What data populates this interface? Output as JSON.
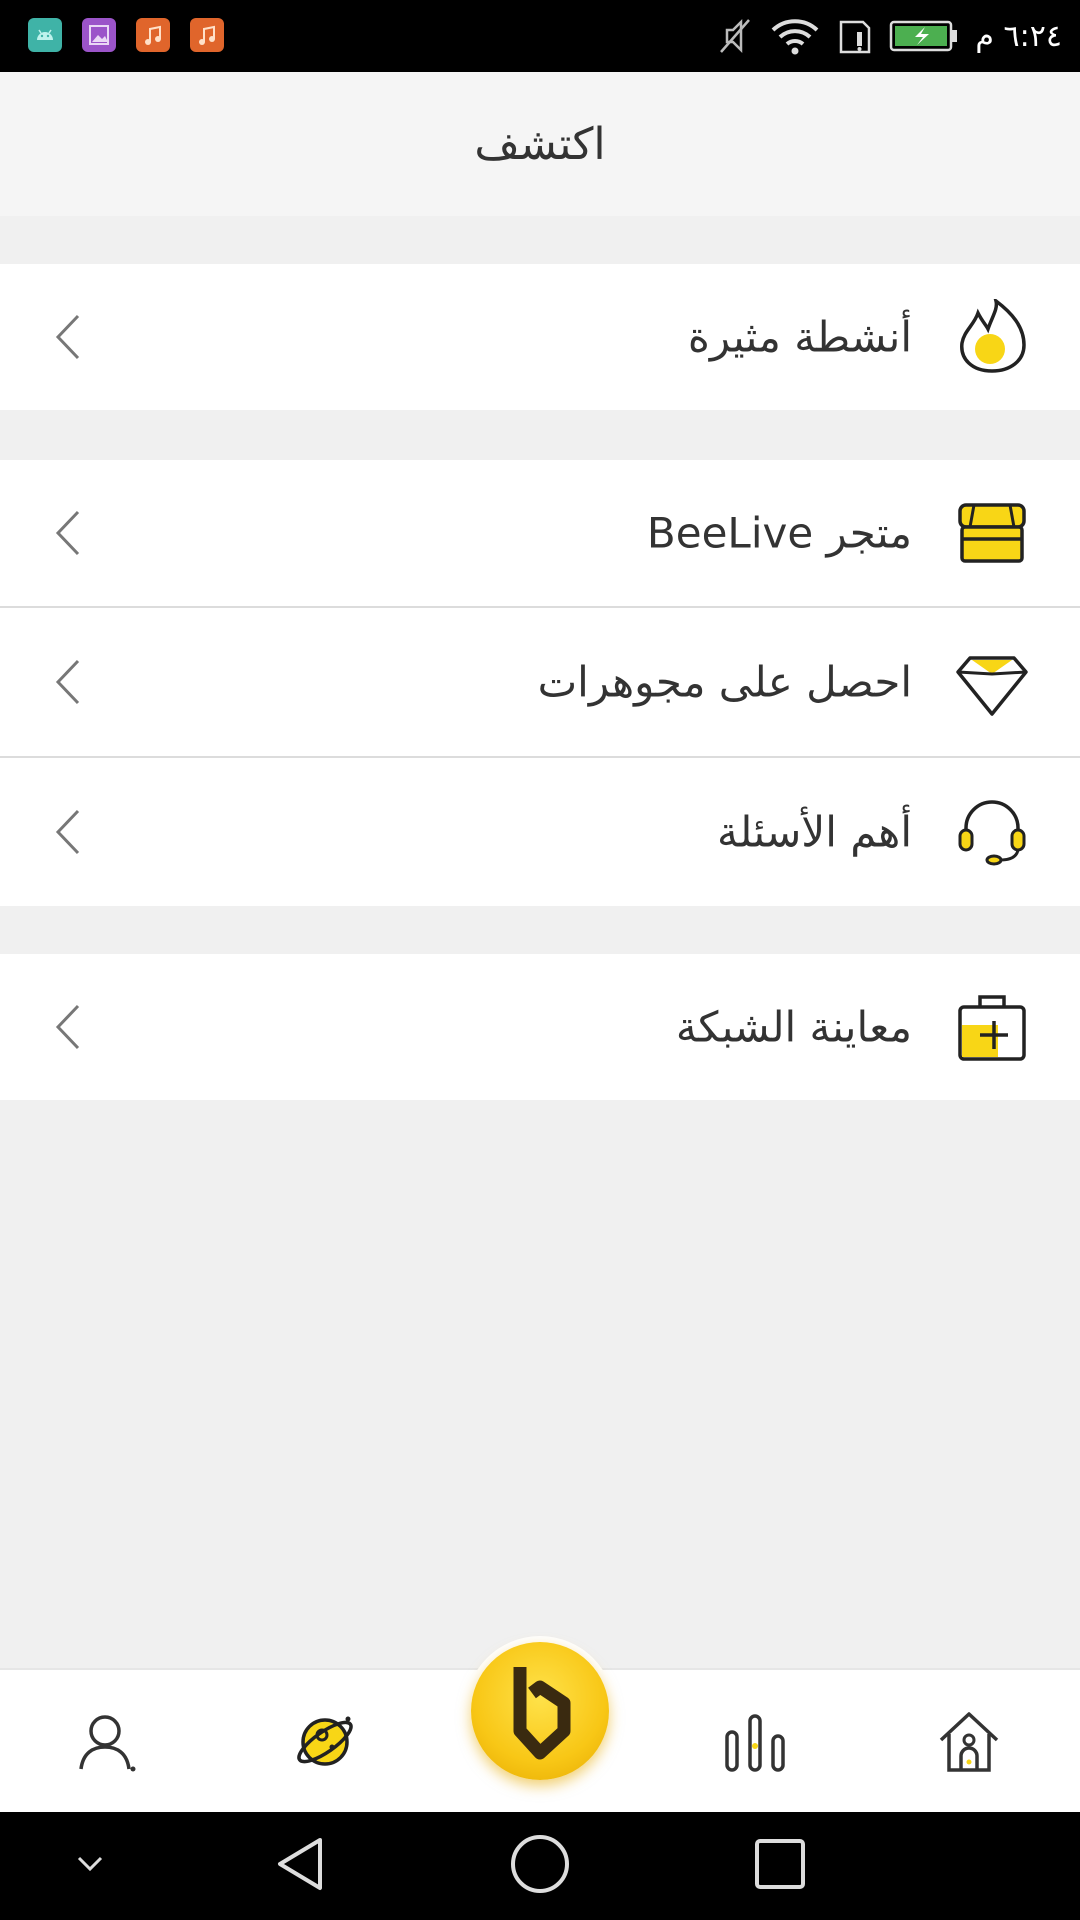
{
  "status_bar": {
    "time": "٦:٢٤ م",
    "notifications": [
      "android-icon",
      "gallery-icon",
      "music-icon",
      "music-icon"
    ]
  },
  "header": {
    "title": "اكتشف"
  },
  "menu": {
    "items": [
      {
        "label": "أنشطة مثيرة",
        "icon": "flame-icon"
      },
      {
        "label": "متجر BeeLive",
        "icon": "store-icon"
      },
      {
        "label": "احصل على مجوهرات",
        "icon": "diamond-icon"
      },
      {
        "label": "أهم الأسئلة",
        "icon": "headset-icon"
      },
      {
        "label": "معاينة الشبكة",
        "icon": "medkit-icon"
      }
    ]
  },
  "bottom_nav": {
    "items": [
      "profile-icon",
      "discover-planet-icon",
      "beelive-logo-button",
      "ranking-icon",
      "home-icon"
    ]
  },
  "colors": {
    "accent": "#f8d616",
    "text": "#333333",
    "background": "#f0f0f0"
  }
}
